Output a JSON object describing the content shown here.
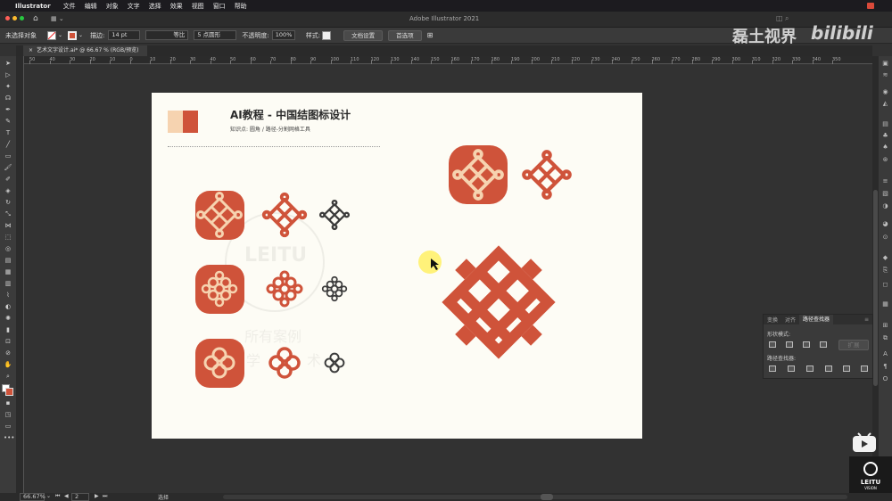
{
  "menubar": {
    "apple": "",
    "app": "Illustrator",
    "items": [
      "文件",
      "编辑",
      "对象",
      "文字",
      "选择",
      "效果",
      "视图",
      "窗口",
      "帮助"
    ]
  },
  "titlebar": {
    "title": "Adobe Illustrator 2021"
  },
  "control": {
    "selection": "未选择对象",
    "stroke_label": "描边:",
    "stroke_value": "14 pt",
    "stroke_style": "等比",
    "brush": "5 点圆形",
    "opacity_label": "不透明度:",
    "opacity_value": "100%",
    "style_label": "样式:",
    "doc_setup": "文档设置",
    "prefs": "首选项"
  },
  "document": {
    "tab": "艺术文字设计.ai* @ 66.67 % (RGB/预览)"
  },
  "ruler": {
    "labels": [
      "50",
      "40",
      "30",
      "20",
      "10",
      "0",
      "10",
      "20",
      "30",
      "40",
      "50",
      "60",
      "70",
      "80",
      "90",
      "100",
      "110",
      "120",
      "130",
      "140",
      "150",
      "160",
      "170",
      "180",
      "190",
      "200",
      "210",
      "220",
      "230",
      "240",
      "250",
      "260",
      "270",
      "280",
      "290",
      "300",
      "310",
      "320",
      "330",
      "340",
      "350"
    ]
  },
  "artboard": {
    "title": "AI教程 - 中国结图标设计",
    "subtitle": "知识点: 圆角 / 路径-分割网格工具",
    "watermark_lines": [
      "所有案例",
      "学",
      "术"
    ],
    "seal_text": "LEITU"
  },
  "colors": {
    "accent": "#cf533a",
    "cream": "#f6d3b0",
    "dark": "#3b3b3b",
    "artboard": "#fdfcf5",
    "cursor_halo": "#fff27a"
  },
  "pathfinder": {
    "tabs": [
      "变换",
      "对齐",
      "路径查找器"
    ],
    "active_tab": "路径查找器",
    "shape_modes_label": "形状模式:",
    "expand_label": "扩展",
    "pathfinders_label": "路径查找器:"
  },
  "status": {
    "zoom": "66.67%",
    "page": "2",
    "tool": "选择"
  },
  "watermark": {
    "channel": "磊土视界",
    "site": "bilibili"
  },
  "logo": {
    "name": "LEITU",
    "sub": "VISION"
  }
}
